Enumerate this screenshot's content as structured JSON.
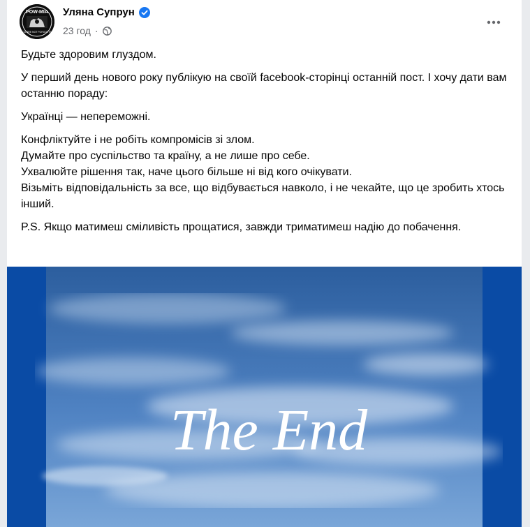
{
  "post": {
    "author_name": "Уляна Супрун",
    "verified_icon": "verified-badge-icon",
    "time": "23 год",
    "separator": "·",
    "audience_icon": "globe-icon",
    "more_icon": "more-options-icon",
    "avatar_text_top": "POW-MIA",
    "avatar_text_bottom": "YOU ARE NOT FORGOTTEN",
    "paragraphs": [
      [
        "Будьте здоровим глуздом."
      ],
      [
        "У перший день нового року публікую на своїй facebook-сторінці останній пост. І хочу дати вам останню пораду:"
      ],
      [
        "Українці — непереможні."
      ],
      [
        "Конфліктуйте і не робіть компромісів зі злом.",
        "Думайте про суспільство та країну, а не лише про себе.",
        "Ухвалюйте рішення так, наче цього більше ні від кого очікувати.",
        "Візьміть відповідальність за все, що відбувається навколо, і не чекайте, що це зробить хтось інший."
      ],
      [
        "P.S. Якщо матимеш сміливість прощатися, завжди триматимеш надію до побачення."
      ]
    ],
    "image": {
      "caption_text": "The End",
      "frame_color": "#0a4ba5",
      "sky_top": "#2c5e9e",
      "sky_bottom": "#7aa6d8"
    }
  }
}
